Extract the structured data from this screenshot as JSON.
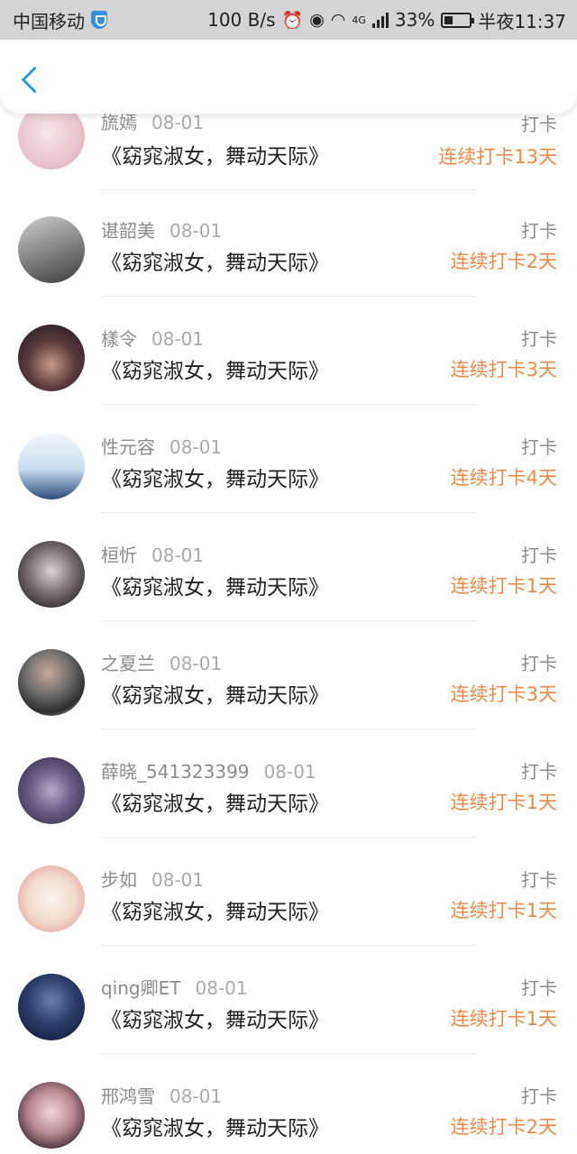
{
  "status_bar": {
    "carrier": "中国移动",
    "speed": "100 B/s",
    "network": "4G",
    "battery": "33%",
    "time": "半夜11:37"
  },
  "header": {
    "back_icon": "chevron-left-icon"
  },
  "accent_color": "#2b9bd8",
  "streak_color": "#ee8a44",
  "entries": [
    {
      "name": "旒嫣",
      "date": "08-01",
      "title": "《窈窕淑女，舞动天际》",
      "action": "打卡",
      "streak": "连续打卡13天"
    },
    {
      "name": "谌韶美",
      "date": "08-01",
      "title": "《窈窕淑女，舞动天际》",
      "action": "打卡",
      "streak": "连续打卡2天"
    },
    {
      "name": "樣令",
      "date": "08-01",
      "title": "《窈窕淑女，舞动天际》",
      "action": "打卡",
      "streak": "连续打卡3天"
    },
    {
      "name": "性元容",
      "date": "08-01",
      "title": "《窈窕淑女，舞动天际》",
      "action": "打卡",
      "streak": "连续打卡4天"
    },
    {
      "name": "桓忻",
      "date": "08-01",
      "title": "《窈窕淑女，舞动天际》",
      "action": "打卡",
      "streak": "连续打卡1天"
    },
    {
      "name": "之夏兰",
      "date": "08-01",
      "title": "《窈窕淑女，舞动天际》",
      "action": "打卡",
      "streak": "连续打卡3天"
    },
    {
      "name": "薛晓_541323399",
      "date": "08-01",
      "title": "《窈窕淑女，舞动天际》",
      "action": "打卡",
      "streak": "连续打卡1天"
    },
    {
      "name": "步如",
      "date": "08-01",
      "title": "《窈窕淑女，舞动天际》",
      "action": "打卡",
      "streak": "连续打卡1天"
    },
    {
      "name": "qing卿ET",
      "date": "08-01",
      "title": "《窈窕淑女，舞动天际》",
      "action": "打卡",
      "streak": "连续打卡1天"
    },
    {
      "name": "邢鸿雪",
      "date": "08-01",
      "title": "《窈窕淑女，舞动天际》",
      "action": "打卡",
      "streak": "连续打卡2天"
    }
  ]
}
